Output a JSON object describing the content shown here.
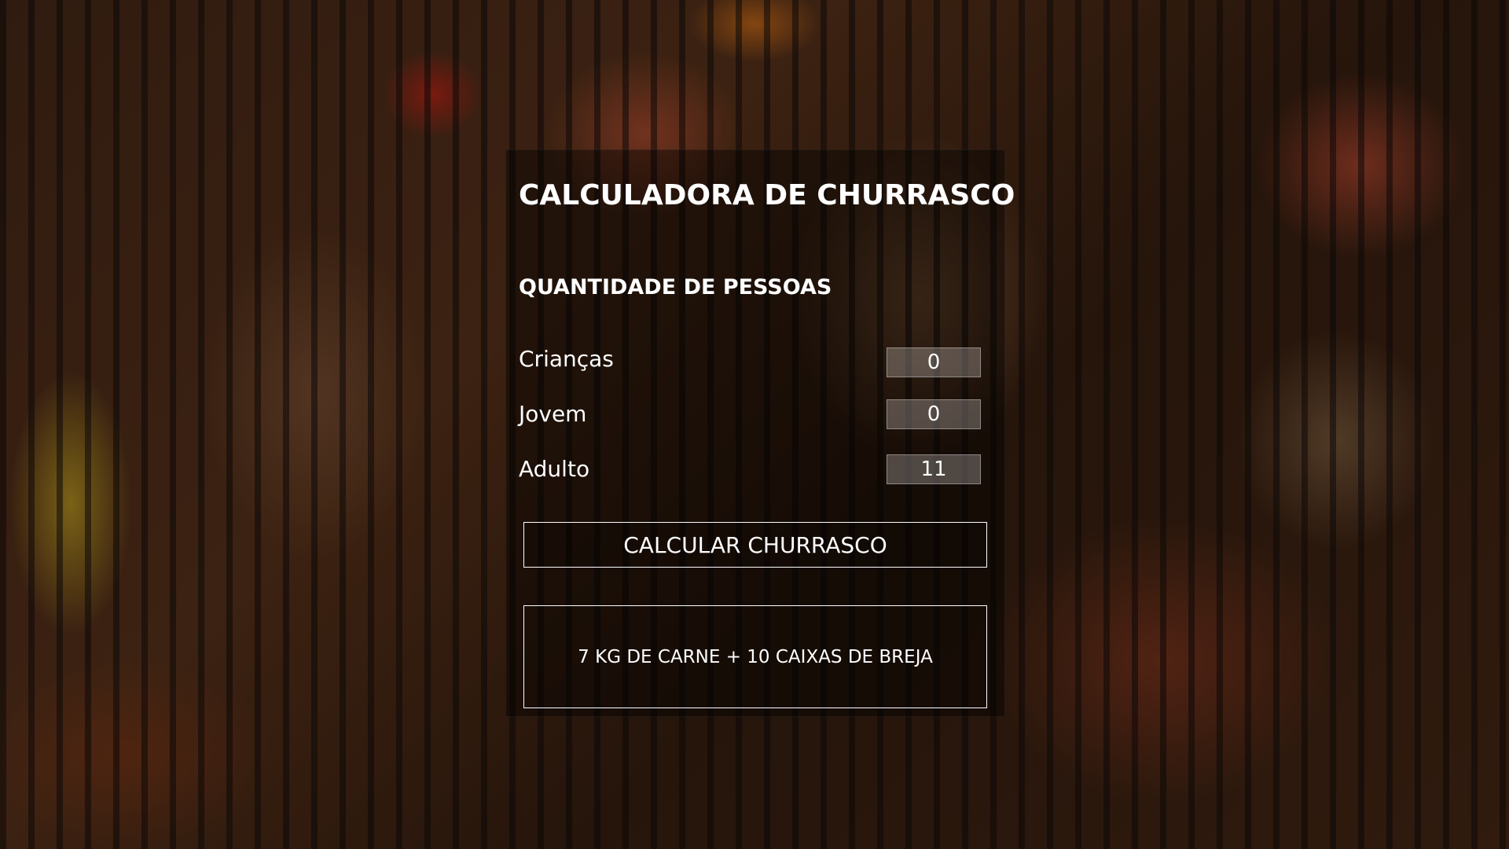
{
  "app": {
    "title": "CALCULADORA DE CHURRASCO"
  },
  "people_section": {
    "heading": "QUANTIDADE DE PESSOAS",
    "fields": [
      {
        "label": "Crianças",
        "value": "0"
      },
      {
        "label": "Jovem",
        "value": "0"
      },
      {
        "label": "Adulto",
        "value": "11"
      }
    ]
  },
  "actions": {
    "calculate_label": "CALCULAR CHURRASCO"
  },
  "result": {
    "text": "7 KG DE CARNE + 10 CAIXAS DE BREJA"
  },
  "background": {
    "image": "grilled-barbecue-meats-photo",
    "overlay_color": "#000000"
  }
}
